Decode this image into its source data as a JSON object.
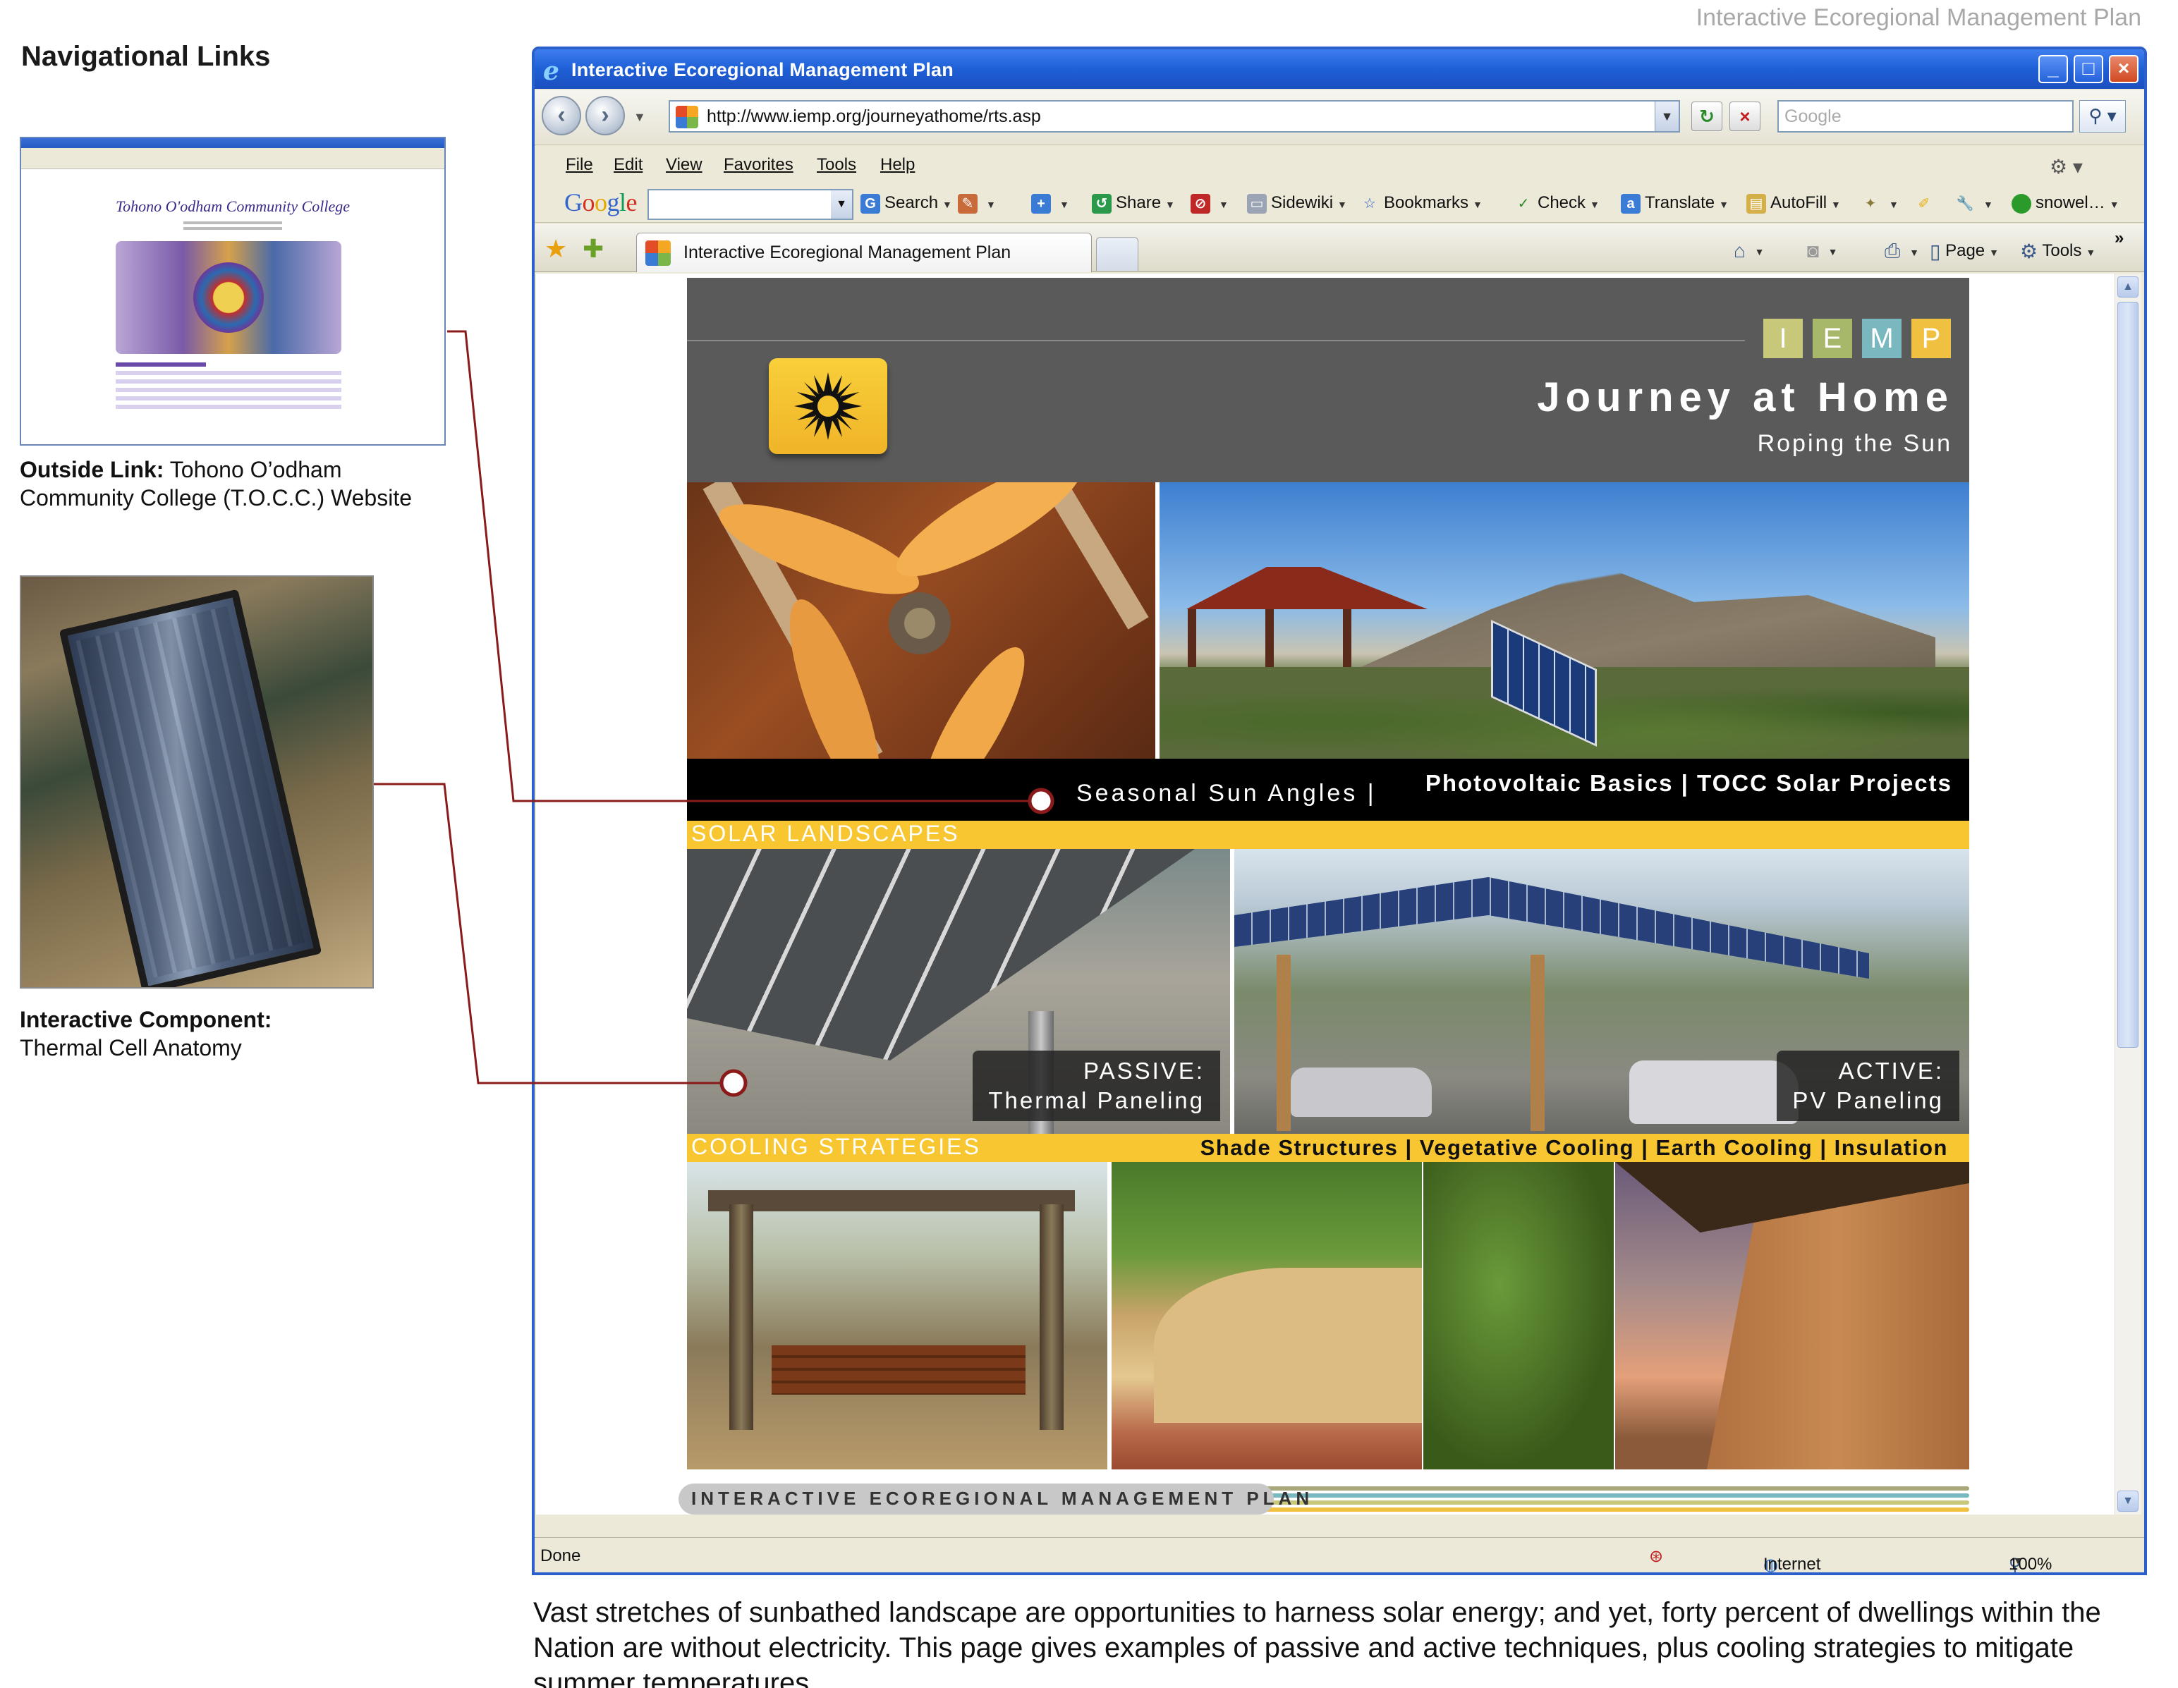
{
  "doc_header": "Interactive Ecoregional Management Plan",
  "nav_heading": "Navigational Links",
  "outside_link": {
    "label": "Outside Link:",
    "text_line1": "Tohono O’odham",
    "text_line2": "Community College (T.O.C.C.) Website",
    "thumb_title": "Tohono O'odham Community College"
  },
  "interactive_component": {
    "label": "Interactive Component:",
    "text": "Thermal Cell Anatomy"
  },
  "browser": {
    "window_title": "Interactive Ecoregional Management Plan",
    "url": "http://www.iemp.org/journeyathome/rts.asp",
    "search_placeholder": "Google",
    "menu": [
      "File",
      "Edit",
      "View",
      "Favorites",
      "Tools",
      "Help"
    ],
    "google_toolbar": {
      "logo": "Google",
      "items": [
        "Search",
        "Share",
        "Sidewiki",
        "Bookmarks",
        "Check",
        "Translate",
        "AutoFill",
        "snowel…"
      ]
    },
    "tab_title": "Interactive Ecoregional Management Plan",
    "command_bar": [
      "Page",
      "Tools"
    ],
    "status": {
      "left": "Done",
      "zone": "Internet",
      "zoom": "100%"
    }
  },
  "page": {
    "iemp_letters": [
      "I",
      "E",
      "M",
      "P"
    ],
    "iemp_colors": [
      "#c8c87a",
      "#a8b86a",
      "#7ab8c0",
      "#f0c040"
    ],
    "title": "Journey at Home",
    "subtitle": "Roping the Sun",
    "nav_links_1": "Seasonal Sun Angles |",
    "nav_links_2": "Photovoltaic Basics | TOCC Solar Projects",
    "solar_label": "SOLAR LANDSCAPES",
    "passive_line1": "PASSIVE:",
    "passive_line2": "Thermal Paneling",
    "active_line1": "ACTIVE:",
    "active_line2": "PV Paneling",
    "cooling_label": "COOLING STRATEGIES",
    "cooling_links": "Shade Structures | Vegetative Cooling | Earth Cooling | Insulation",
    "footer_text": "INTERACTIVE ECOREGIONAL MANAGEMENT PLAN"
  },
  "caption": "Vast stretches of sunbathed landscape are opportunities to harness solar energy; and yet, forty percent of dwellings within the Nation are without electricity. This page gives examples of passive and active techniques, plus cooling strategies to mitigate summer temperatures.",
  "colors": {
    "accent_yellow": "#f8c630",
    "callout_red": "#8b1a1a",
    "xp_blue": "#2b5fcc"
  }
}
